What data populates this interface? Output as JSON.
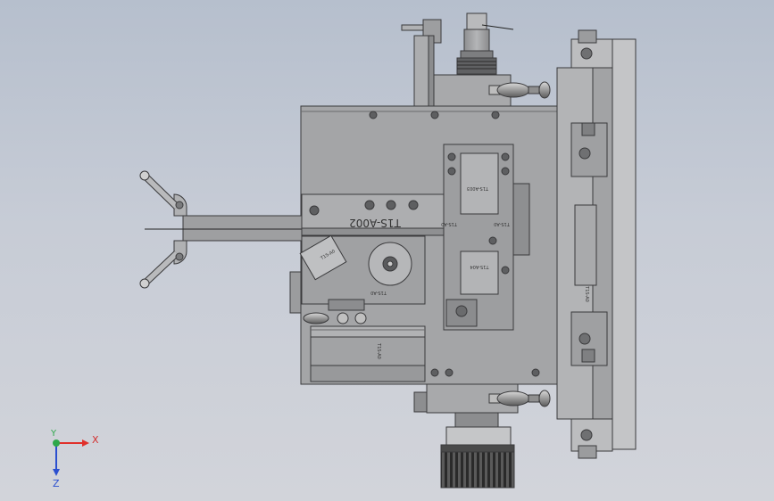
{
  "labels": {
    "main_bar": "T1S-A002",
    "small_1": "T1S-A003",
    "small_2": "T1S-A0",
    "small_3": "T1S-A0",
    "small_4": "T1S-A04",
    "small_5": "T1S-A0",
    "small_6": "T1S-A0",
    "small_7": "T1S-A0",
    "small_8": "T1S-A0"
  },
  "triad": {
    "x_label": "X",
    "y_label": "Y",
    "z_label": "Z",
    "x_color": "#e0302b",
    "y_color": "#2fa84a",
    "z_color": "#2b4fcf"
  },
  "colors": {
    "metal": "#a6a7a9",
    "metal_dark": "#6f7072",
    "edge": "#3a3a3c",
    "panel": "#9c9d9f"
  }
}
